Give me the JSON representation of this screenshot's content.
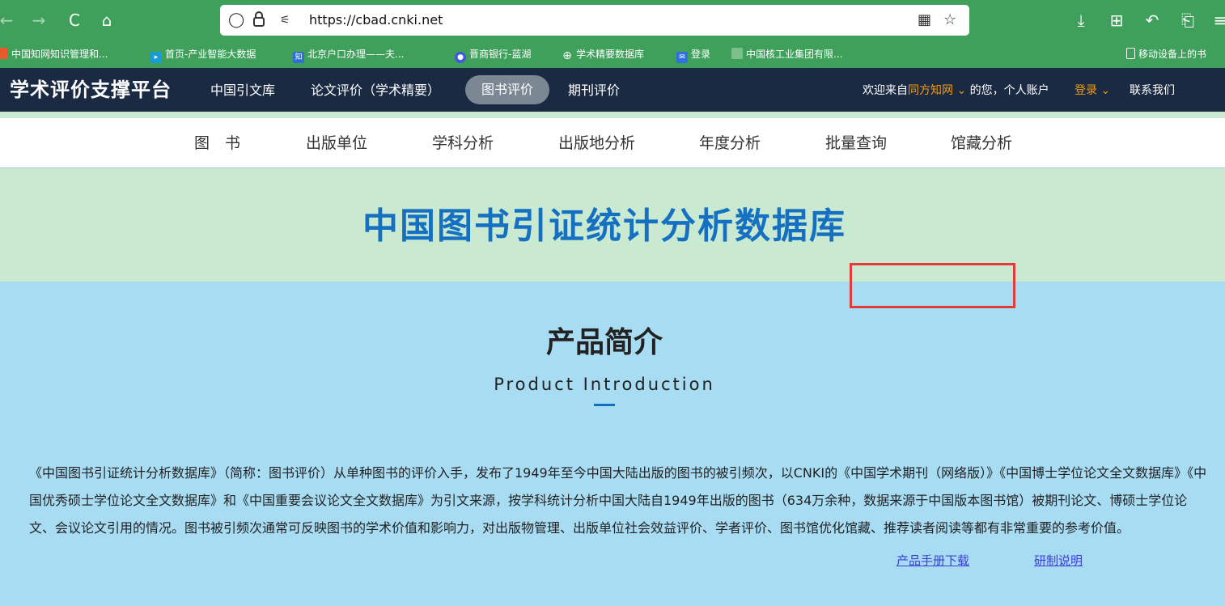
{
  "browser": {
    "back": "←",
    "forward": "→",
    "reload": "C",
    "home": "⌂",
    "url": "https://cbad.cnki.net",
    "right_icons": [
      "⤓",
      "⊞",
      "↶",
      "⎗",
      "≡"
    ]
  },
  "bookmarks": [
    "中国知网知识管理和...",
    "首页-产业智能大数据",
    "北京户口办理——夫...",
    "晋商银行-蓝湖",
    "学术精要数据库",
    "登录",
    "中国核工业集团有限...",
    "移动设备上的书"
  ],
  "header": {
    "brand": "学术评价支撑平台",
    "nav": [
      "中国引文库",
      "论文评价（学术精要）",
      "图书评价",
      "期刊评价"
    ],
    "welcome_prefix": "欢迎来自",
    "org": "同方知网",
    "welcome_suffix": "的您，个人账户",
    "login": "登录",
    "contact": "联系我们"
  },
  "sub_nav": [
    "图　书",
    "出版单位",
    "学科分析",
    "出版地分析",
    "年度分析",
    "批量查询",
    "馆藏分析"
  ],
  "hero": {
    "title": "中国图书引证统计分析数据库"
  },
  "intro": {
    "title": "产品简介",
    "subtitle": "Product Introduction",
    "text": "《中国图书引证统计分析数据库》（简称：图书评价）从单种图书的评价入手，发布了1949年至今中国大陆出版的图书的被引频次，以CNKI的《中国学术期刊（网络版）》《中国博士学位论文全文数据库》《中国优秀硕士学位论文全文数据库》和《中国重要会议论文全文数据库》为引文来源，按学科统计分析中国大陆自1949年出版的图书（634万余种，数据来源于中国版本图书馆）被期刊论文、博硕士学位论文、会议论文引用的情况。图书被引频次通常可反映图书的学术价值和影响力，对出版物管理、出版单位社会效益评价、学者评价、图书馆优化馆藏、推荐读者阅读等都有非常重要的参考价值。",
    "link_manual": "产品手册下载",
    "link_notes": "研制说明"
  },
  "colors": {
    "browser_green": "#3fa05c",
    "header_navy": "#1a2a43",
    "hero_bg": "#c9ead0",
    "intro_bg": "#a8dcf3",
    "title_blue": "#1670c2",
    "accent_orange": "#f39c12",
    "highlight_red": "#e33a3a"
  }
}
